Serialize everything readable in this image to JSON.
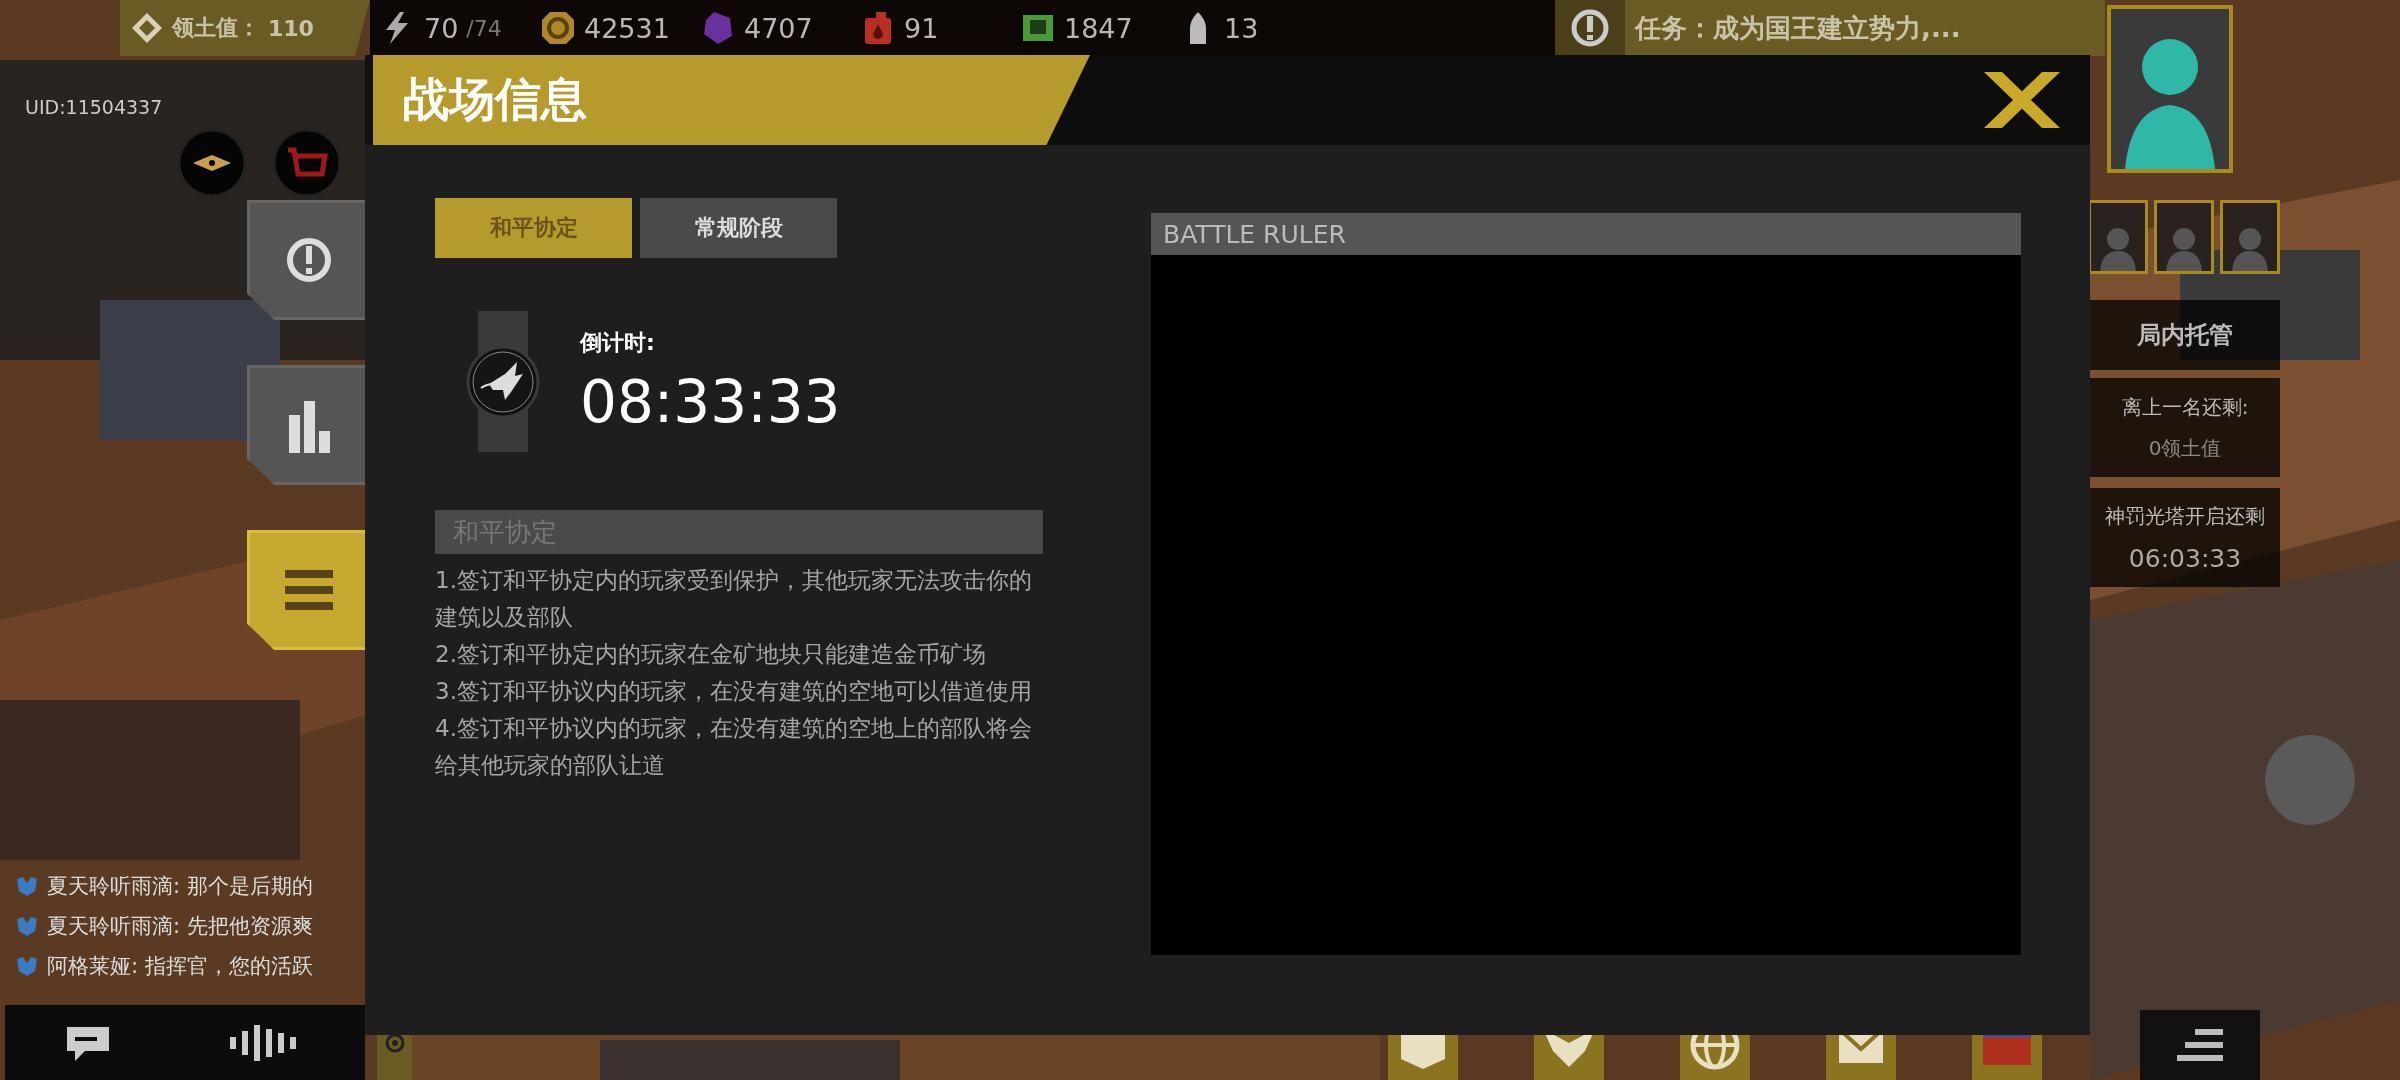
{
  "hud": {
    "territory": {
      "label": "领土值：",
      "value": "110"
    },
    "resources": [
      {
        "kind": "energy",
        "value": "70",
        "max": "/74"
      },
      {
        "kind": "coin",
        "value": "42531"
      },
      {
        "kind": "crystal",
        "value": "4707"
      },
      {
        "kind": "fuel",
        "value": "91"
      },
      {
        "kind": "chip",
        "value": "1847"
      },
      {
        "kind": "ammo",
        "value": "13"
      }
    ],
    "mission": "任务：成为国王建立势力,...",
    "uid": "UID:11504337"
  },
  "side_buttons": [
    {
      "kind": "alert",
      "selected": false
    },
    {
      "kind": "stats",
      "selected": false
    },
    {
      "kind": "menu",
      "selected": true
    }
  ],
  "right_panel": {
    "auto": "局内托管",
    "rank_label": "离上一名还剩:",
    "rank_value": "0领土值",
    "tower_label": "神罚光塔开启还剩",
    "tower_time": "06:03:33"
  },
  "chat": [
    {
      "text": "夏天聆听雨滴: 那个是后期的"
    },
    {
      "text": "夏天聆听雨滴: 先把他资源爽"
    },
    {
      "text": "阿格莱娅: 指挥官，您的活跃"
    }
  ],
  "dialog": {
    "title": "战场信息",
    "tabs": [
      {
        "label": "和平协定",
        "selected": true
      },
      {
        "label": "常规阶段",
        "selected": false
      }
    ],
    "countdown_label": "倒计时:",
    "countdown": "08:33:33",
    "section_title": "和平协定",
    "rules": [
      "1.签订和平协定内的玩家受到保护，其他玩家无法攻击你的建筑以及部队",
      "2.签订和平协定内的玩家在金矿地块只能建造金币矿场",
      "3.签订和平协议内的玩家，在没有建筑的空地可以借道使用",
      "4.签订和平协议内的玩家，在没有建筑的空地上的部队将会给其他玩家的部队让道"
    ],
    "panel_title": "BATTLE RULER"
  }
}
